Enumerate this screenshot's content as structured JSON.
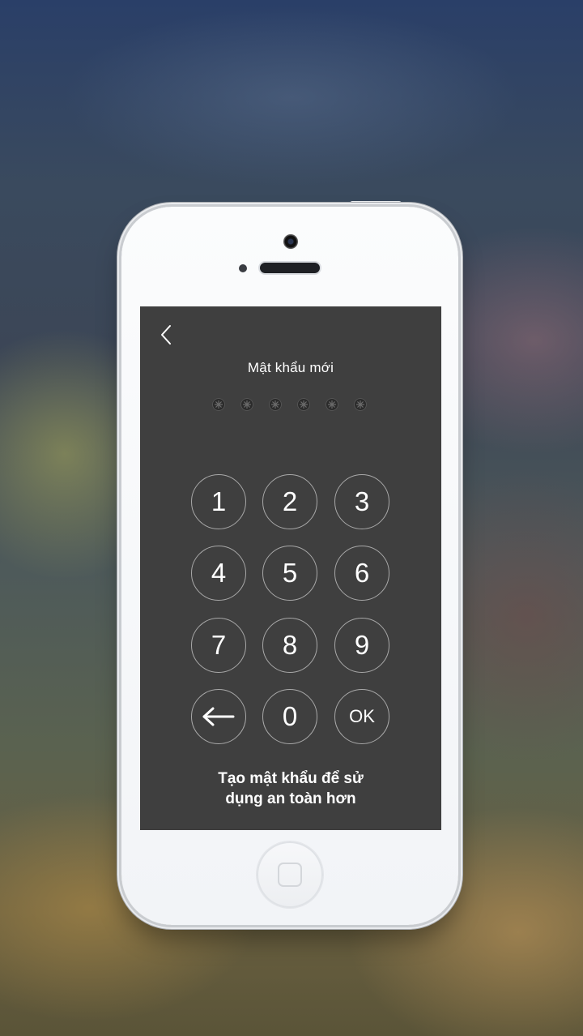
{
  "screen": {
    "back_icon": "chevron-left-icon",
    "title": "Mật khẩu mới",
    "pin_length": 6,
    "entered_digits": 0
  },
  "keypad": {
    "keys": [
      "1",
      "2",
      "3",
      "4",
      "5",
      "6",
      "7",
      "8",
      "9",
      "←",
      "0",
      "OK"
    ],
    "backspace_icon": "arrow-left-icon"
  },
  "hint": {
    "line1": "Tạo mật khẩu để sử",
    "line2": "dụng an toàn hơn"
  },
  "colors": {
    "screen_bg": "#3f3f3f",
    "key_border": "#a8a8a8",
    "text": "#ffffff"
  }
}
